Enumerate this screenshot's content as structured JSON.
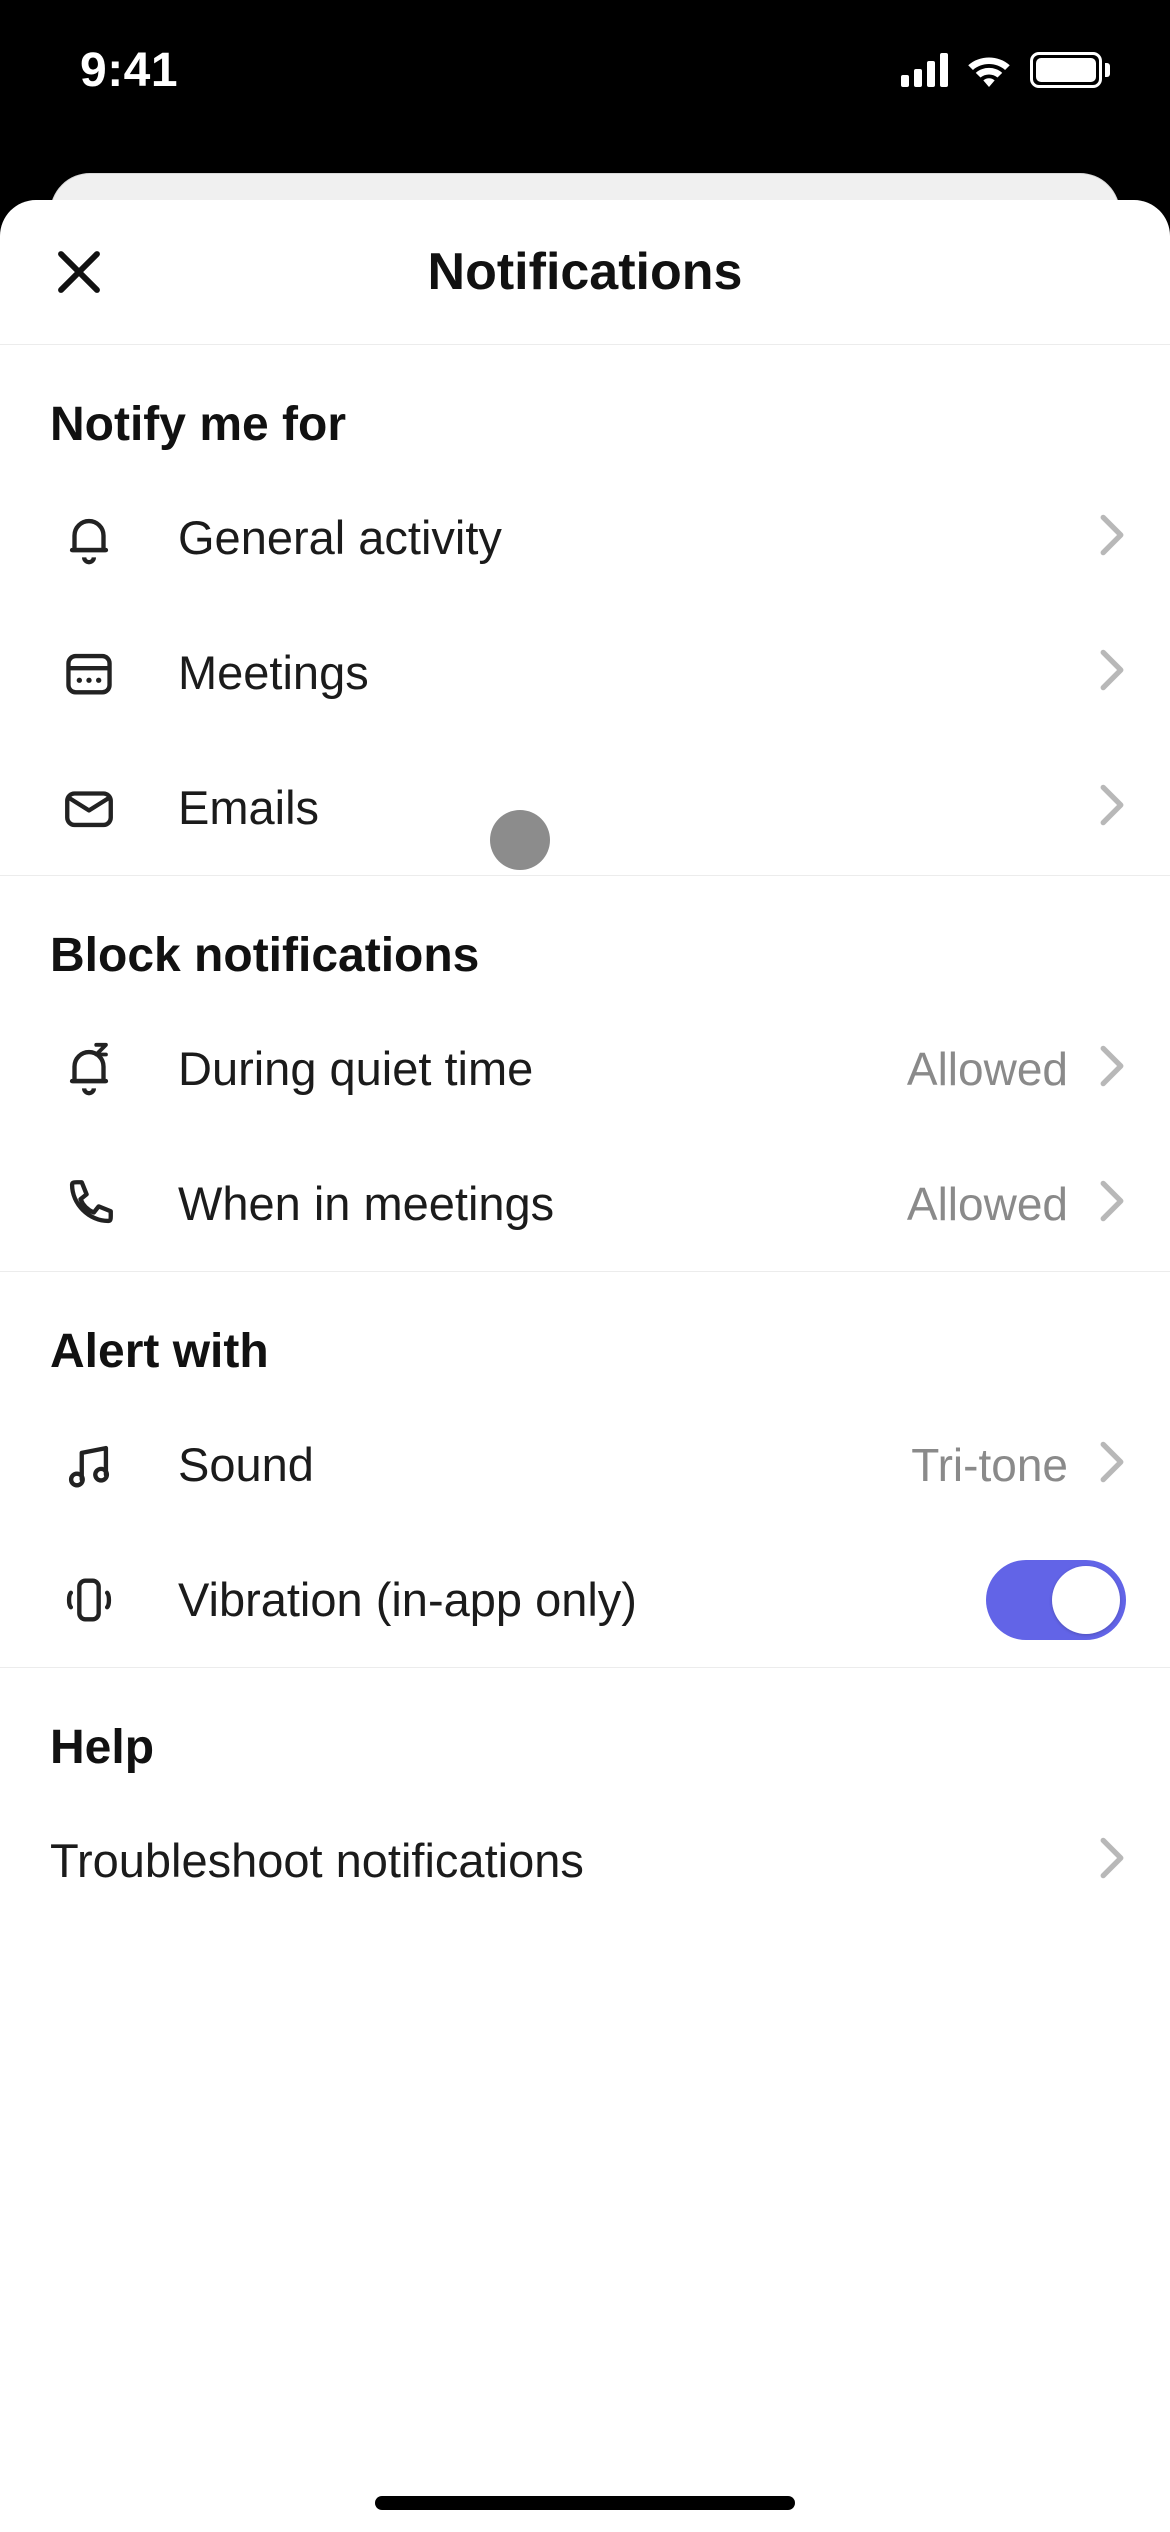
{
  "statusbar": {
    "time": "9:41"
  },
  "header": {
    "title": "Notifications"
  },
  "notify": {
    "title": "Notify me for",
    "items": [
      {
        "label": "General activity"
      },
      {
        "label": "Meetings"
      },
      {
        "label": "Emails"
      }
    ]
  },
  "block": {
    "title": "Block notifications",
    "items": [
      {
        "label": "During quiet time",
        "value": "Allowed"
      },
      {
        "label": "When in meetings",
        "value": "Allowed"
      }
    ]
  },
  "alert": {
    "title": "Alert with",
    "sound": {
      "label": "Sound",
      "value": "Tri-tone"
    },
    "vibration": {
      "label": "Vibration (in-app only)",
      "enabled": true
    }
  },
  "help": {
    "title": "Help",
    "troubleshoot": {
      "label": "Troubleshoot notifications"
    }
  }
}
